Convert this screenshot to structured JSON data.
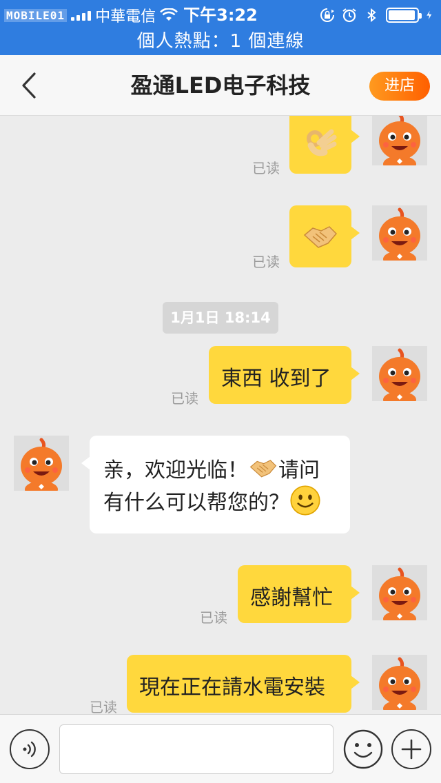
{
  "status_bar": {
    "watermark": "MOBILE01",
    "carrier": "中華電信",
    "time": "下午3:22",
    "hotspot": "個人熱點：1 個連線",
    "battery_level": 0.95,
    "icons": [
      "signal-icon",
      "wifi-icon",
      "rotation-lock-icon",
      "alarm-icon",
      "bluetooth-icon",
      "battery-icon",
      "charging-icon"
    ]
  },
  "nav": {
    "title": "盈通LED电子科技",
    "enter_shop": "进店",
    "back_icon": "chevron-left-icon"
  },
  "chat": {
    "timestamp": "1月1日 18:14",
    "read_label": "已读",
    "messages": [
      {
        "from": "me",
        "type": "emoji",
        "emoji": "ok-hand-icon",
        "status": "已读"
      },
      {
        "from": "me",
        "type": "emoji",
        "emoji": "handshake-icon",
        "status": "已读"
      },
      {
        "from": "me",
        "type": "text",
        "text": "東西 收到了",
        "status": "已读"
      },
      {
        "from": "seller",
        "type": "text",
        "line1_a": "亲，欢迎光临！",
        "line1_b": "请问",
        "line2": "有什么可以帮您的？",
        "emojis": [
          "handshake-icon",
          "smile-icon"
        ]
      },
      {
        "from": "me",
        "type": "text",
        "text": "感謝幫忙",
        "status": "已读"
      },
      {
        "from": "me",
        "type": "text",
        "text": "現在正在請水電安裝",
        "status": "已读"
      }
    ]
  },
  "input_bar": {
    "placeholder": "",
    "value": "",
    "icons": [
      "voice-icon",
      "emoji-icon",
      "plus-icon"
    ]
  },
  "colors": {
    "status_bar": "#2f7de0",
    "my_bubble": "#ffd83d",
    "their_bubble": "#ffffff",
    "enter_shop_gradient": [
      "#ff9a1f",
      "#ff5f00"
    ],
    "background": "#ececec"
  }
}
